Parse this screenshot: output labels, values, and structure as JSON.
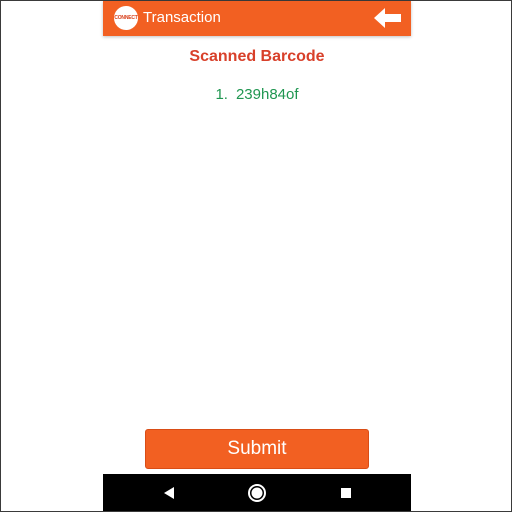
{
  "app_bar": {
    "logo_text": "CONNECT",
    "title": "Transaction",
    "color": "#f26022",
    "back_icon": "arrow-left-icon"
  },
  "scanned": {
    "heading": "Scanned Barcode",
    "heading_color": "#d8402a",
    "items": [
      {
        "number": "1.",
        "code": "239h84of"
      }
    ],
    "item_color": "#1f9650"
  },
  "submit": {
    "label": "Submit",
    "color": "#f26022"
  },
  "system_nav": {
    "icons": [
      "nav-back-icon",
      "nav-home-icon",
      "nav-recents-icon"
    ]
  }
}
